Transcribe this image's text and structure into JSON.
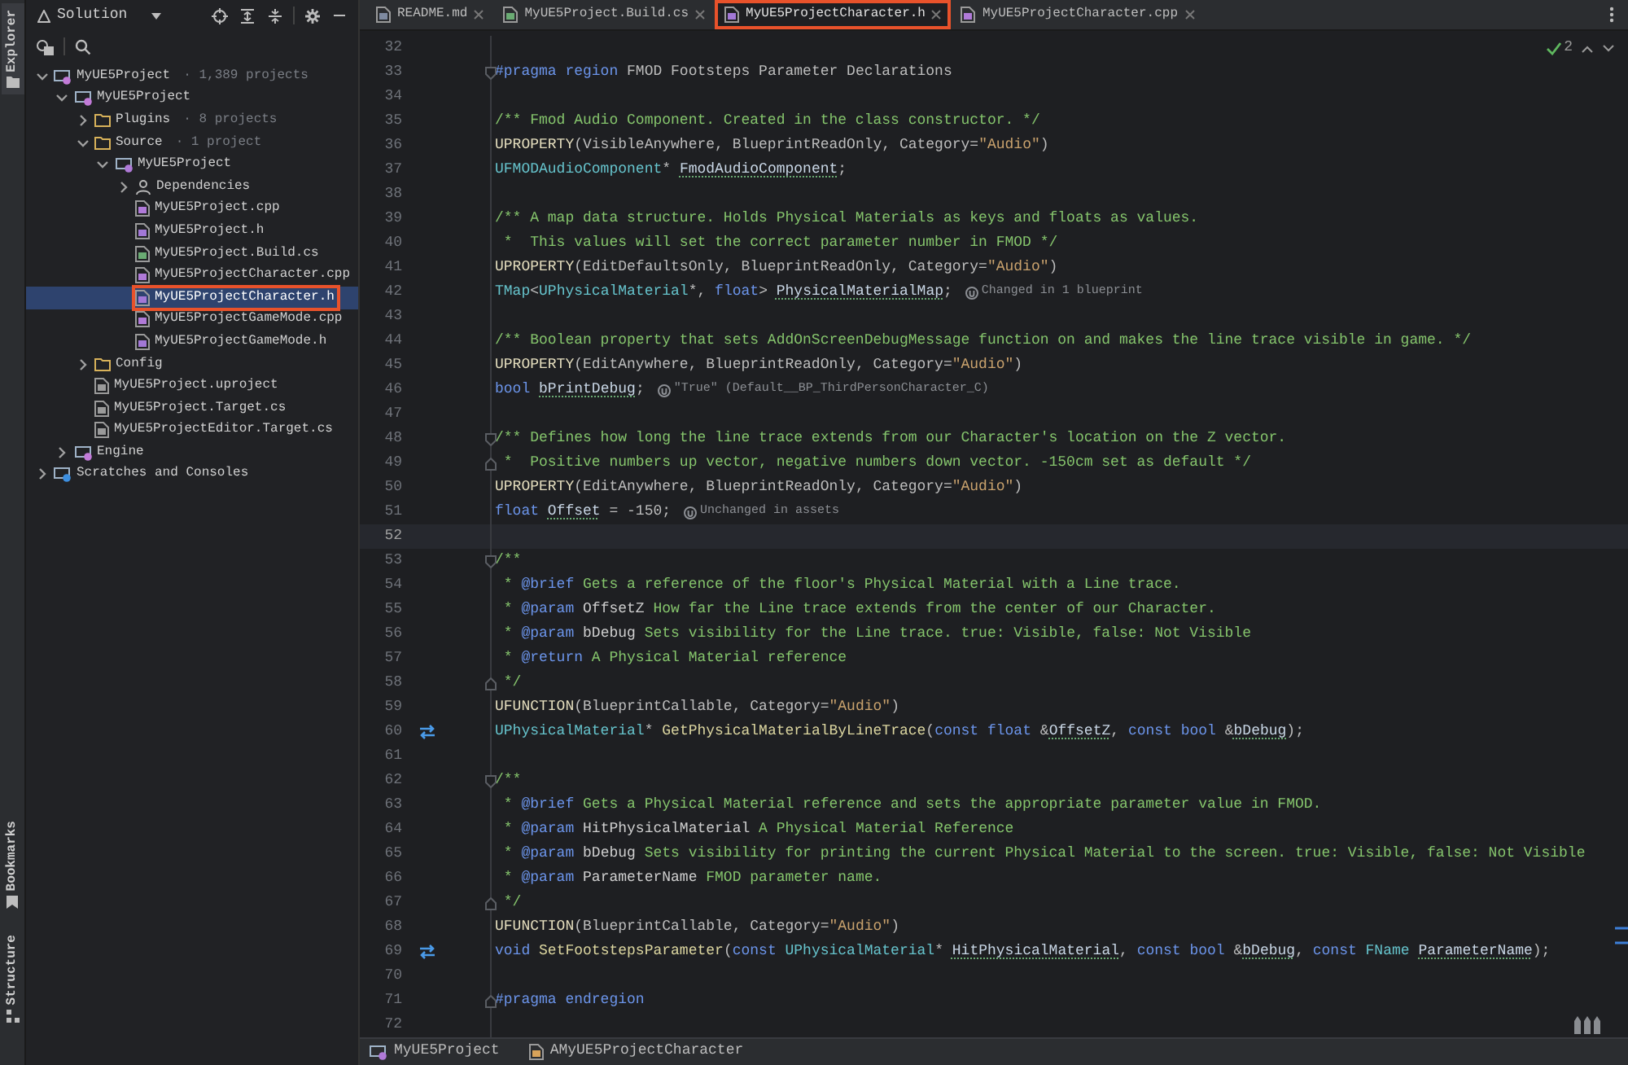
{
  "left_strip": {
    "top": [
      {
        "label": "Explorer",
        "kind": "folder",
        "selected": true
      }
    ],
    "bottom": [
      {
        "label": "Bookmarks",
        "kind": "bookmark",
        "selected": false
      },
      {
        "label": "Structure",
        "kind": "structure",
        "selected": false
      }
    ]
  },
  "sidebar": {
    "title": "Solution",
    "tree": [
      {
        "label": "MyUE5Project",
        "note": "· 1,389 projects",
        "kind": "solution",
        "expanded": true,
        "selected": false,
        "children": [
          {
            "label": "MyUE5Project",
            "kind": "project",
            "expanded": true,
            "selected": false,
            "children": [
              {
                "label": "Plugins",
                "note": "· 8 projects",
                "kind": "folder",
                "expanded": false,
                "selected": false
              },
              {
                "label": "Source",
                "note": "· 1 project",
                "kind": "folder",
                "expanded": true,
                "selected": false,
                "children": [
                  {
                    "label": "MyUE5Project",
                    "kind": "module",
                    "expanded": true,
                    "selected": false,
                    "children": [
                      {
                        "label": "Dependencies",
                        "kind": "deps",
                        "expanded": false,
                        "selected": false
                      },
                      {
                        "label": "MyUE5Project.cpp",
                        "kind": "cpp",
                        "selected": false
                      },
                      {
                        "label": "MyUE5Project.h",
                        "kind": "h",
                        "selected": false
                      },
                      {
                        "label": "MyUE5Project.Build.cs",
                        "kind": "cs",
                        "selected": false
                      },
                      {
                        "label": "MyUE5ProjectCharacter.cpp",
                        "kind": "cpp",
                        "selected": false
                      },
                      {
                        "label": "MyUE5ProjectCharacter.h",
                        "kind": "h",
                        "selected": true,
                        "outlined": true
                      },
                      {
                        "label": "MyUE5ProjectGameMode.cpp",
                        "kind": "cpp",
                        "selected": false
                      },
                      {
                        "label": "MyUE5ProjectGameMode.h",
                        "kind": "h",
                        "selected": false
                      }
                    ]
                  }
                ]
              },
              {
                "label": "Config",
                "kind": "folder",
                "expanded": false,
                "selected": false
              },
              {
                "label": "MyUE5Project.uproject",
                "kind": "uproject",
                "selected": false
              },
              {
                "label": "MyUE5Project.Target.cs",
                "kind": "target",
                "selected": false
              },
              {
                "label": "MyUE5ProjectEditor.Target.cs",
                "kind": "target",
                "selected": false
              }
            ]
          },
          {
            "label": "Engine",
            "kind": "project",
            "expanded": false,
            "selected": false
          }
        ]
      },
      {
        "label": "Scratches and Consoles",
        "kind": "scratch",
        "expanded": false,
        "selected": false
      }
    ]
  },
  "tabs": [
    {
      "label": "README.md",
      "kind": "md",
      "selected": false
    },
    {
      "label": "MyUE5Project.Build.cs",
      "kind": "cs",
      "selected": false
    },
    {
      "label": "MyUE5ProjectCharacter.h",
      "kind": "h",
      "selected": true,
      "outlined": true
    },
    {
      "label": "MyUE5ProjectCharacter.cpp",
      "kind": "cpp",
      "selected": false
    }
  ],
  "inspections": {
    "count": "2"
  },
  "editor": {
    "lines": [
      {
        "n": "32",
        "kind": "plain"
      },
      {
        "n": "33",
        "kind": "fold-start",
        "tokens": [
          {
            "kind": "kw",
            "text": "#pragma region"
          },
          {
            "kind": "pl",
            "text": " FMOD Footsteps Parameter Declarations"
          }
        ]
      },
      {
        "n": "34",
        "kind": "plain"
      },
      {
        "n": "35",
        "kind": "plain",
        "tokens": [
          {
            "kind": "cm",
            "text": "/** Fmod Audio Component. Created in the class constructor. */"
          }
        ]
      },
      {
        "n": "36",
        "kind": "plain",
        "tokens": [
          {
            "kind": "mc",
            "text": "UPROPERTY"
          },
          {
            "kind": "pl",
            "text": "(VisibleAnywhere, BlueprintReadOnly, Category="
          },
          {
            "kind": "st",
            "text": "\"Audio\""
          },
          {
            "kind": "pl",
            "text": ")"
          }
        ]
      },
      {
        "n": "37",
        "kind": "plain",
        "tokens": [
          {
            "kind": "ty",
            "text": "UFMODAudioComponent"
          },
          {
            "kind": "pl",
            "text": "* "
          },
          {
            "kind": "fl",
            "text": "FmodAudioComponent"
          },
          {
            "kind": "pl",
            "text": ";"
          }
        ]
      },
      {
        "n": "38",
        "kind": "plain"
      },
      {
        "n": "39",
        "kind": "plain",
        "tokens": [
          {
            "kind": "cm",
            "text": "/** A map data structure. Holds Physical Materials as keys and floats as values."
          }
        ]
      },
      {
        "n": "40",
        "kind": "plain",
        "tokens": [
          {
            "kind": "cm",
            "text": " *  This values will set the correct parameter number in FMOD */"
          }
        ]
      },
      {
        "n": "41",
        "kind": "plain",
        "tokens": [
          {
            "kind": "mc",
            "text": "UPROPERTY"
          },
          {
            "kind": "pl",
            "text": "(EditDefaultsOnly, BlueprintReadOnly, Category="
          },
          {
            "kind": "st",
            "text": "\"Audio\""
          },
          {
            "kind": "pl",
            "text": ")"
          }
        ]
      },
      {
        "n": "42",
        "kind": "plain",
        "tokens": [
          {
            "kind": "ty",
            "text": "TMap"
          },
          {
            "kind": "pl",
            "text": "<"
          },
          {
            "kind": "ty",
            "text": "UPhysicalMaterial"
          },
          {
            "kind": "pl",
            "text": "*, "
          },
          {
            "kind": "kw",
            "text": "float"
          },
          {
            "kind": "pl",
            "text": "> "
          },
          {
            "kind": "fl",
            "text": "PhysicalMaterialMap"
          },
          {
            "kind": "pl",
            "text": ";"
          }
        ],
        "hint": "Changed in 1 blueprint"
      },
      {
        "n": "43",
        "kind": "plain"
      },
      {
        "n": "44",
        "kind": "plain",
        "tokens": [
          {
            "kind": "cm",
            "text": "/** Boolean property that sets AddOnScreenDebugMessage function on and makes the line trace visible in game. */"
          }
        ]
      },
      {
        "n": "45",
        "kind": "plain",
        "tokens": [
          {
            "kind": "mc",
            "text": "UPROPERTY"
          },
          {
            "kind": "pl",
            "text": "(EditAnywhere, BlueprintReadOnly, Category="
          },
          {
            "kind": "st",
            "text": "\"Audio\""
          },
          {
            "kind": "pl",
            "text": ")"
          }
        ]
      },
      {
        "n": "46",
        "kind": "plain",
        "tokens": [
          {
            "kind": "kw",
            "text": "bool "
          },
          {
            "kind": "fl",
            "text": "bPrintDebug"
          },
          {
            "kind": "pl",
            "text": ";"
          }
        ],
        "hint": "\"True\" (Default__BP_ThirdPersonCharacter_C)"
      },
      {
        "n": "47",
        "kind": "plain"
      },
      {
        "n": "48",
        "kind": "fold-start",
        "tokens": [
          {
            "kind": "cm",
            "text": "/** Defines how long the line trace extends from our Character's location on the Z vector."
          }
        ]
      },
      {
        "n": "49",
        "kind": "fold-end",
        "tokens": [
          {
            "kind": "cm",
            "text": " *  Positive numbers up vector, negative numbers down vector. -150cm set as default */"
          }
        ]
      },
      {
        "n": "50",
        "kind": "plain",
        "tokens": [
          {
            "kind": "mc",
            "text": "UPROPERTY"
          },
          {
            "kind": "pl",
            "text": "(EditAnywhere, BlueprintReadOnly, Category="
          },
          {
            "kind": "st",
            "text": "\"Audio\""
          },
          {
            "kind": "pl",
            "text": ")"
          }
        ]
      },
      {
        "n": "51",
        "kind": "plain",
        "tokens": [
          {
            "kind": "kw",
            "text": "float "
          },
          {
            "kind": "fl",
            "text": "Offset"
          },
          {
            "kind": "pl",
            "text": " = -150;"
          }
        ],
        "hint": "Unchanged in assets"
      },
      {
        "n": "52",
        "kind": "plain",
        "current": true
      },
      {
        "n": "53",
        "kind": "fold-start",
        "tokens": [
          {
            "kind": "cm",
            "text": "/**"
          }
        ]
      },
      {
        "n": "54",
        "kind": "plain",
        "tokens": [
          {
            "kind": "cm",
            "text": " * "
          },
          {
            "kind": "dt",
            "text": "@brief"
          },
          {
            "kind": "cm",
            "text": " Gets a reference of the floor's Physical Material with a Line trace."
          }
        ]
      },
      {
        "n": "55",
        "kind": "plain",
        "tokens": [
          {
            "kind": "cm",
            "text": " * "
          },
          {
            "kind": "dt",
            "text": "@param "
          },
          {
            "kind": "dp",
            "text": "OffsetZ"
          },
          {
            "kind": "cm",
            "text": " How far the Line trace extends from the center of our Character."
          }
        ]
      },
      {
        "n": "56",
        "kind": "plain",
        "tokens": [
          {
            "kind": "cm",
            "text": " * "
          },
          {
            "kind": "dt",
            "text": "@param "
          },
          {
            "kind": "dp",
            "text": "bDebug"
          },
          {
            "kind": "cm",
            "text": " Sets visibility for the Line trace. true: Visible, false: Not Visible"
          }
        ]
      },
      {
        "n": "57",
        "kind": "plain",
        "tokens": [
          {
            "kind": "cm",
            "text": " * "
          },
          {
            "kind": "dt",
            "text": "@return"
          },
          {
            "kind": "cm",
            "text": " A Physical Material reference"
          }
        ]
      },
      {
        "n": "58",
        "kind": "fold-end",
        "tokens": [
          {
            "kind": "cm",
            "text": " */"
          }
        ]
      },
      {
        "n": "59",
        "kind": "plain",
        "tokens": [
          {
            "kind": "mc",
            "text": "UFUNCTION"
          },
          {
            "kind": "pl",
            "text": "(BlueprintCallable, Category="
          },
          {
            "kind": "st",
            "text": "\"Audio\""
          },
          {
            "kind": "pl",
            "text": ")"
          }
        ]
      },
      {
        "n": "60",
        "kind": "impl",
        "tokens": [
          {
            "kind": "ty",
            "text": "UPhysicalMaterial"
          },
          {
            "kind": "pl",
            "text": "* "
          },
          {
            "kind": "fn",
            "text": "GetPhysicalMaterialByLineTrace"
          },
          {
            "kind": "pl",
            "text": "("
          },
          {
            "kind": "kw",
            "text": "const float"
          },
          {
            "kind": "pl",
            "text": " &"
          },
          {
            "kind": "fl",
            "text": "OffsetZ"
          },
          {
            "kind": "pl",
            "text": ", "
          },
          {
            "kind": "kw",
            "text": "const bool"
          },
          {
            "kind": "pl",
            "text": " &"
          },
          {
            "kind": "fl",
            "text": "bDebug"
          },
          {
            "kind": "pl",
            "text": ");"
          }
        ]
      },
      {
        "n": "61",
        "kind": "plain"
      },
      {
        "n": "62",
        "kind": "fold-start",
        "tokens": [
          {
            "kind": "cm",
            "text": "/**"
          }
        ]
      },
      {
        "n": "63",
        "kind": "plain",
        "tokens": [
          {
            "kind": "cm",
            "text": " * "
          },
          {
            "kind": "dt",
            "text": "@brief"
          },
          {
            "kind": "cm",
            "text": " Gets a Physical Material reference and sets the appropriate parameter value in FMOD."
          }
        ]
      },
      {
        "n": "64",
        "kind": "plain",
        "tokens": [
          {
            "kind": "cm",
            "text": " * "
          },
          {
            "kind": "dt",
            "text": "@param "
          },
          {
            "kind": "dp",
            "text": "HitPhysicalMaterial"
          },
          {
            "kind": "cm",
            "text": " A Physical Material Reference"
          }
        ]
      },
      {
        "n": "65",
        "kind": "plain",
        "tokens": [
          {
            "kind": "cm",
            "text": " * "
          },
          {
            "kind": "dt",
            "text": "@param "
          },
          {
            "kind": "dp",
            "text": "bDebug"
          },
          {
            "kind": "cm",
            "text": " Sets visibility for printing the current Physical Material to the screen. true: Visible, false: Not Visible"
          }
        ]
      },
      {
        "n": "66",
        "kind": "plain",
        "tokens": [
          {
            "kind": "cm",
            "text": " * "
          },
          {
            "kind": "dt",
            "text": "@param "
          },
          {
            "kind": "dp",
            "text": "ParameterName"
          },
          {
            "kind": "cm",
            "text": " FMOD parameter name."
          }
        ]
      },
      {
        "n": "67",
        "kind": "fold-end",
        "tokens": [
          {
            "kind": "cm",
            "text": " */"
          }
        ]
      },
      {
        "n": "68",
        "kind": "plain",
        "tokens": [
          {
            "kind": "mc",
            "text": "UFUNCTION"
          },
          {
            "kind": "pl",
            "text": "(BlueprintCallable, Category="
          },
          {
            "kind": "st",
            "text": "\"Audio\""
          },
          {
            "kind": "pl",
            "text": ")"
          }
        ]
      },
      {
        "n": "69",
        "kind": "impl",
        "tokens": [
          {
            "kind": "kw",
            "text": "void "
          },
          {
            "kind": "fn",
            "text": "SetFootstepsParameter"
          },
          {
            "kind": "pl",
            "text": "("
          },
          {
            "kind": "kw",
            "text": "const "
          },
          {
            "kind": "ty",
            "text": "UPhysicalMaterial"
          },
          {
            "kind": "pl",
            "text": "* "
          },
          {
            "kind": "fl",
            "text": "HitPhysicalMaterial"
          },
          {
            "kind": "pl",
            "text": ", "
          },
          {
            "kind": "kw",
            "text": "const bool"
          },
          {
            "kind": "pl",
            "text": " &"
          },
          {
            "kind": "fl",
            "text": "bDebug"
          },
          {
            "kind": "pl",
            "text": ", "
          },
          {
            "kind": "kw",
            "text": "const "
          },
          {
            "kind": "ty",
            "text": "FName "
          },
          {
            "kind": "fl",
            "text": "ParameterName"
          },
          {
            "kind": "pl",
            "text": ");"
          }
        ]
      },
      {
        "n": "70",
        "kind": "plain"
      },
      {
        "n": "71",
        "kind": "fold-end",
        "tokens": [
          {
            "kind": "kw",
            "text": "#pragma endregion"
          }
        ]
      },
      {
        "n": "72",
        "kind": "plain"
      }
    ]
  },
  "breadcrumbs": [
    {
      "label": "MyUE5Project",
      "kind": "module"
    },
    {
      "label": "AMyUE5ProjectCharacter",
      "kind": "class"
    }
  ]
}
